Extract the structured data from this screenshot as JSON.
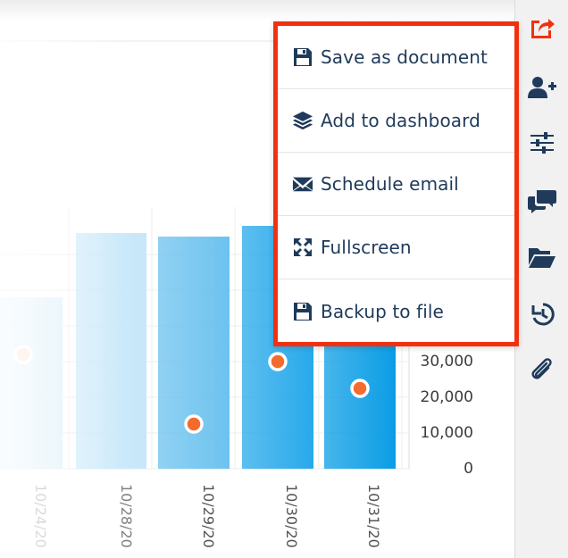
{
  "colors": {
    "accent_border": "#f2300f",
    "menu_text": "#1f3a5a",
    "icon": "#1f3a5a",
    "marker": "#f46b2e",
    "bar_dark": "#0a9de5"
  },
  "menu": {
    "items": [
      {
        "label": "Save as document",
        "icon": "floppy-icon"
      },
      {
        "label": "Add to dashboard",
        "icon": "layers-icon"
      },
      {
        "label": "Schedule email",
        "icon": "envelope-icon"
      },
      {
        "label": "Fullscreen",
        "icon": "fullscreen-icon"
      },
      {
        "label": "Backup to file",
        "icon": "floppy-icon"
      }
    ]
  },
  "toolbar": {
    "buttons": [
      {
        "name": "share-icon",
        "active": true
      },
      {
        "name": "add-user-icon"
      },
      {
        "name": "sliders-icon"
      },
      {
        "name": "comments-icon"
      },
      {
        "name": "folder-open-icon"
      },
      {
        "name": "history-icon"
      },
      {
        "name": "paperclip-icon"
      }
    ]
  },
  "chart_data": {
    "type": "bar",
    "categories": [
      "10/24/20",
      "10/28/20",
      "10/29/20",
      "10/30/20",
      "10/31/20"
    ],
    "series": [
      {
        "type": "bar",
        "values": [
          48000,
          66000,
          65000,
          68000,
          68000
        ]
      },
      {
        "type": "scatter",
        "values": [
          32000,
          null,
          12500,
          30000,
          22500
        ]
      }
    ],
    "ylim": [
      0,
      70000
    ],
    "y_ticks": [
      "0",
      "10,000",
      "20,000",
      "30,000"
    ],
    "grid": true
  }
}
